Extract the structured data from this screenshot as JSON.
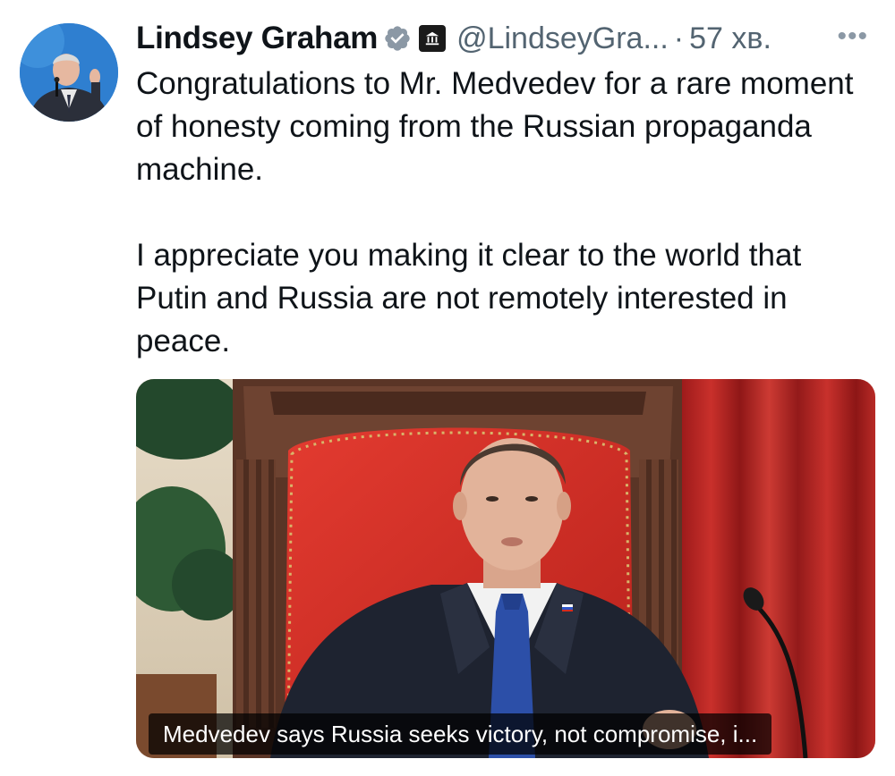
{
  "tweet": {
    "author": {
      "display_name": "Lindsey Graham",
      "handle": "@LindseyGra...",
      "verified_icon": "verified-badge-icon",
      "affiliation_icon": "government-building-icon"
    },
    "separator": "·",
    "timestamp": "57 хв.",
    "more_label": "•••",
    "paragraphs": [
      "Congratulations to Mr. Medvedev for a rare moment of honesty coming from the Russian propaganda machine.",
      "I appreciate you making it clear to the world that Putin and Russia are not remotely interested in peace."
    ],
    "media": {
      "caption": "Medvedev says Russia seeks victory, not compromise, i..."
    }
  },
  "colors": {
    "text_primary": "#0f1419",
    "text_secondary": "#536471",
    "verified_blue": "#1d9bf0"
  }
}
